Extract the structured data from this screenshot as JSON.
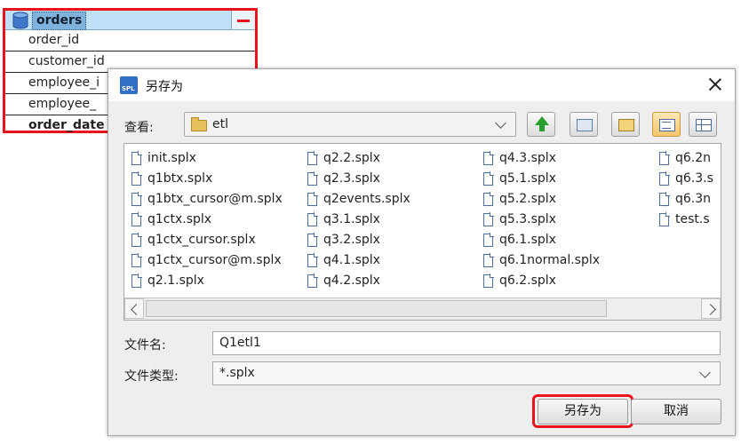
{
  "table_widget": {
    "title": "orders",
    "rows": [
      "order_id",
      "customer_id",
      "employee_i",
      "employee_",
      "order_date"
    ]
  },
  "dialog": {
    "title": "另存为",
    "look_in_label": "查看:",
    "look_in_value": "etl",
    "file_columns": [
      [
        "init.splx",
        "q1btx.splx",
        "q1btx_cursor@m.splx",
        "q1ctx.splx",
        "q1ctx_cursor.splx",
        "q1ctx_cursor@m.splx",
        "q2.1.splx"
      ],
      [
        "q2.2.splx",
        "q2.3.splx",
        "q2events.splx",
        "q3.1.splx",
        "q3.2.splx",
        "q4.1.splx",
        "q4.2.splx"
      ],
      [
        "q4.3.splx",
        "q5.1.splx",
        "q5.2.splx",
        "q5.3.splx",
        "q6.1.splx",
        "q6.1normal.splx",
        "q6.2.splx"
      ],
      [
        "q6.2n",
        "q6.3.s",
        "q6.3n",
        "test.s"
      ]
    ],
    "file_name_label": "文件名:",
    "file_name_value": "Q1etl1",
    "file_type_label": "文件类型:",
    "file_type_value": "*.splx",
    "save_button": "另存为",
    "cancel_button": "取消",
    "app_icon_text": "SPL"
  },
  "colors": {
    "highlight": "#e8141b",
    "table_header": "#bfe0f7",
    "dialog_bg": "#eeeeee"
  },
  "icons": [
    "database-icon",
    "minus-icon",
    "close-icon",
    "folder-icon",
    "up-folder-icon",
    "home-folder-icon",
    "new-folder-icon",
    "list-view-icon",
    "details-view-icon",
    "file-icon"
  ]
}
